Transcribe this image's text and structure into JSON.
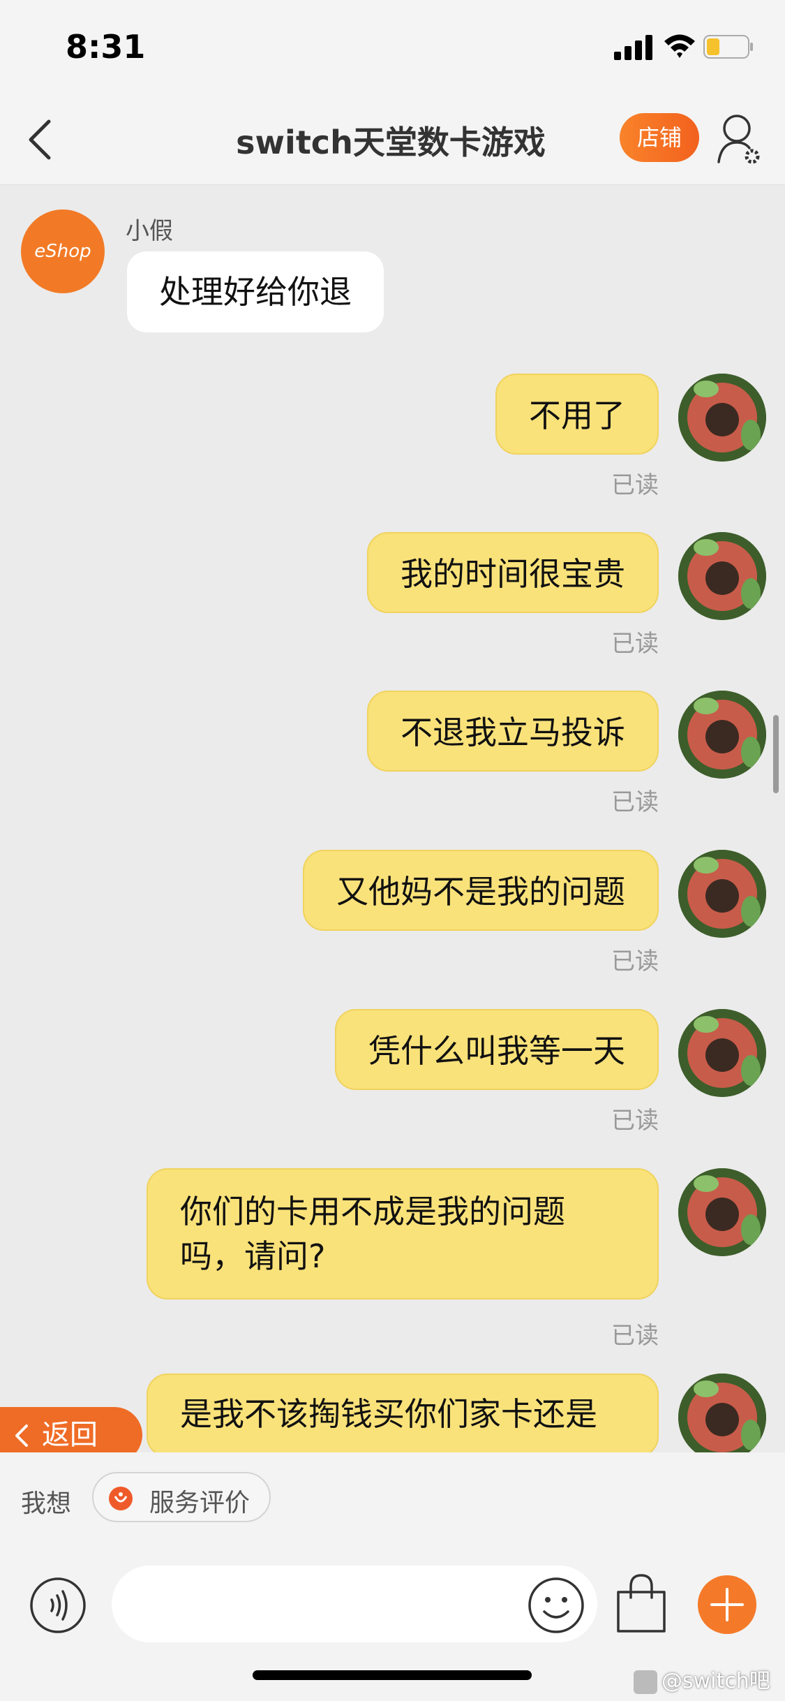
{
  "status_bar": {
    "time": "8:31"
  },
  "nav": {
    "title": "switch天堂数卡游戏",
    "store_label": "店铺"
  },
  "incoming": {
    "avatar_text": "eShop",
    "sender": "小假",
    "message": "处理好给你退"
  },
  "outgoing": [
    {
      "text": "不用了",
      "status": "已读"
    },
    {
      "text": "我的时间很宝贵",
      "status": "已读"
    },
    {
      "text": "不退我立马投诉",
      "status": "已读"
    },
    {
      "text": "又他妈不是我的问题",
      "status": "已读"
    },
    {
      "text": "凭什么叫我等一天",
      "status": "已读"
    },
    {
      "text": "你们的卡用不成是我的问题吗，请问?",
      "status": "已读"
    },
    {
      "text": "是我不该掏钱买你们家卡还是"
    }
  ],
  "return_button": {
    "label": "返回"
  },
  "quick_bar": {
    "label": "我想",
    "chip_label": "服务评价"
  },
  "input": {
    "placeholder": ""
  },
  "watermark": "@switch吧",
  "colors": {
    "accent": "#f47a2a",
    "bubble_out": "#fae27a",
    "bubble_in": "#ffffff"
  }
}
